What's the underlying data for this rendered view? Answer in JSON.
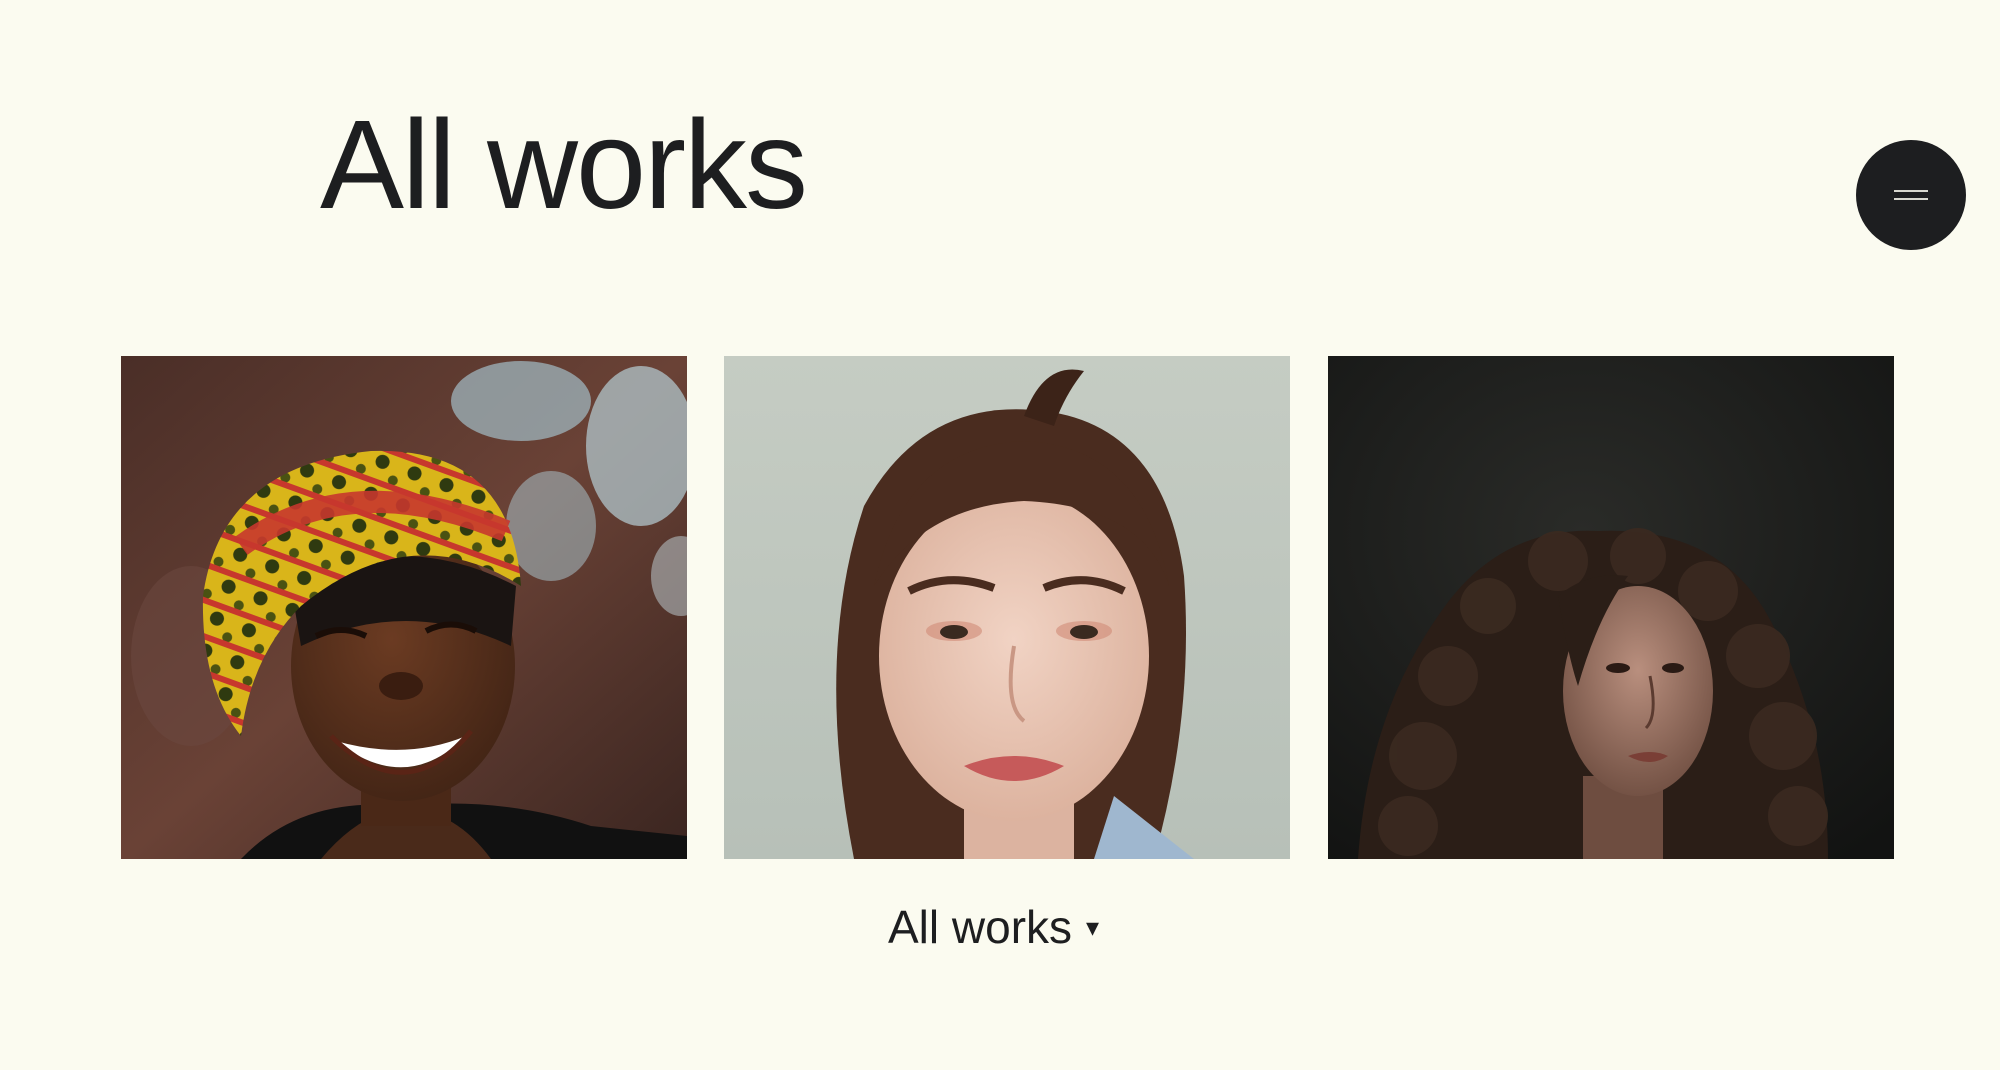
{
  "page": {
    "title": "All works",
    "background": "#fbfbf0",
    "text_color": "#1d1e20"
  },
  "menu": {
    "icon": "hamburger-icon",
    "color": "#1d1e20"
  },
  "gallery": {
    "items": [
      {
        "subject": "smiling woman in yellow and red patterned headwrap",
        "background": "#5a3a30"
      },
      {
        "subject": "woman with ponytail on pale grey background",
        "background": "#c8cfc6"
      },
      {
        "subject": "woman with long curly hair on dark background",
        "background": "#1e1f1d"
      }
    ]
  },
  "filter": {
    "label": "All works",
    "caret_icon": "caret-down-icon",
    "caret": "▾"
  }
}
